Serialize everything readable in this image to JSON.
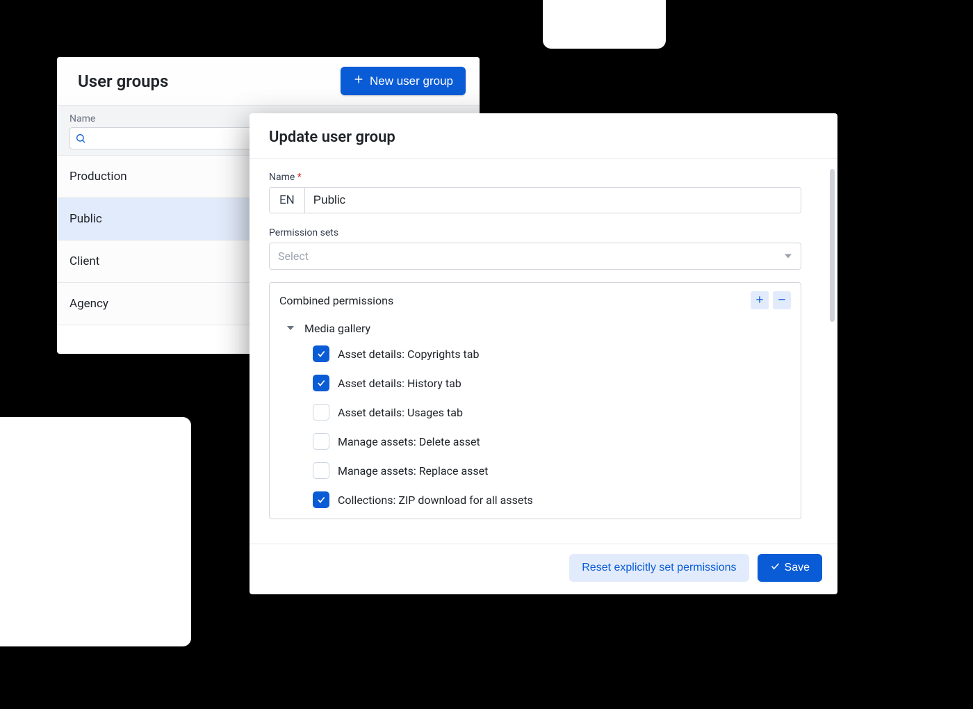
{
  "left_panel": {
    "title": "User groups",
    "new_button_label": "New user group",
    "column_label": "Name",
    "search_value": "",
    "rows": [
      {
        "label": "Production",
        "selected": false
      },
      {
        "label": "Public",
        "selected": true
      },
      {
        "label": "Client",
        "selected": false
      },
      {
        "label": "Agency",
        "selected": false
      }
    ]
  },
  "right_panel": {
    "title": "Update user group",
    "name_label": "Name",
    "name_lang": "EN",
    "name_value": "Public",
    "permission_sets_label": "Permission sets",
    "permission_sets_placeholder": "Select",
    "combined_permissions_label": "Combined permissions",
    "tree": {
      "group_label": "Media gallery",
      "items": [
        {
          "label": "Asset details: Copyrights tab",
          "checked": true
        },
        {
          "label": "Asset details: History tab",
          "checked": true
        },
        {
          "label": "Asset details: Usages tab",
          "checked": false
        },
        {
          "label": "Manage assets: Delete asset",
          "checked": false
        },
        {
          "label": "Manage assets: Replace asset",
          "checked": false
        },
        {
          "label": "Collections: ZIP download for all assets",
          "checked": true
        }
      ]
    },
    "reset_button_label": "Reset explicitly set permissions",
    "save_button_label": "Save"
  }
}
